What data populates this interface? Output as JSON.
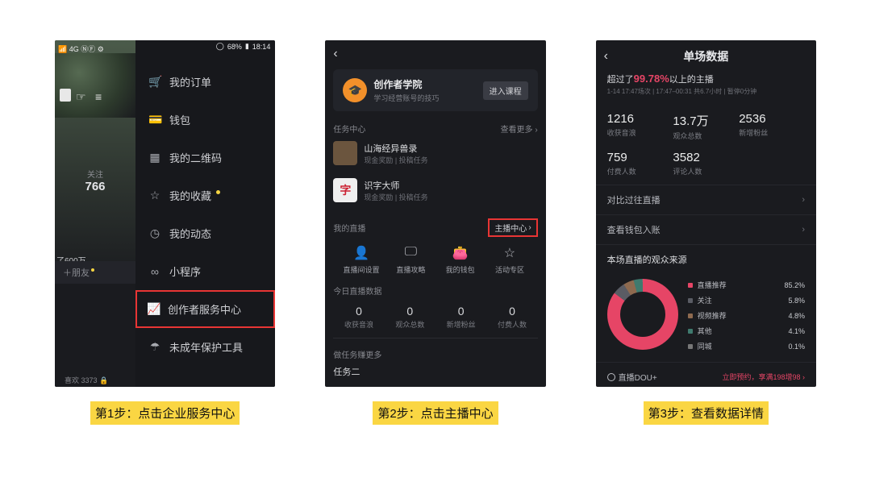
{
  "captions": {
    "step1": "第1步：点击企业服务中心",
    "step2": "第2步：点击主播中心",
    "step3": "第3步：查看数据详情"
  },
  "phone1": {
    "status_left_icons": "📶 4G ⓃⒻ ⚙",
    "battery": "68%",
    "time": "18:14",
    "follow_label": "关注",
    "follow_count": "766",
    "fans_text": "了600万",
    "add_friend": "＋朋友",
    "likes_text": "喜欢 3373",
    "lock_icon": "🔒",
    "menu": {
      "orders": "我的订单",
      "wallet": "钱包",
      "qrcode": "我的二维码",
      "fav": "我的收藏",
      "moments": "我的动态",
      "miniapp": "小程序",
      "creator": "创作者服务中心",
      "minor": "未成年保护工具"
    }
  },
  "phone2": {
    "academy": {
      "title": "创作者学院",
      "sub": "学习经营账号的技巧",
      "btn": "进入课程"
    },
    "task_header": "任务中心",
    "see_more": "查看更多 ›",
    "task1": {
      "title": "山海经异兽录",
      "sub": "现金奖励 | 投稿任务"
    },
    "task2": {
      "title": "识字大师",
      "thumb_char": "字",
      "sub": "现金奖励 | 投稿任务"
    },
    "my_live": "我的直播",
    "zb_center": "主播中心",
    "tools": {
      "t1": "直播间设置",
      "t2": "直播攻略",
      "t3": "我的钱包",
      "t4": "活动专区"
    },
    "today_header": "今日直播数据",
    "stats": {
      "s1v": "0",
      "s1l": "收获音浪",
      "s2v": "0",
      "s2l": "观众总数",
      "s3v": "0",
      "s3l": "新增粉丝",
      "s4v": "0",
      "s4l": "付费人数"
    },
    "more_task": "做任务赚更多",
    "task_two": "任务二"
  },
  "phone3": {
    "title": "单场数据",
    "exceed_pre": "超过了",
    "exceed_pct": "99.78%",
    "exceed_post": "以上的主播",
    "time_line": "1-14 17:47场次 | 17:47–00:31 共6.7小时 | 暂停0分钟",
    "grid": {
      "c1v": "1216",
      "c1l": "收获音浪",
      "c2v": "13.7万",
      "c2l": "观众总数",
      "c3v": "2536",
      "c3l": "新增粉丝",
      "c4v": "759",
      "c4l": "付费人数",
      "c5v": "3582",
      "c5l": "评论人数"
    },
    "compare": "对比过往直播",
    "wallet_in": "查看钱包入账",
    "source_title": "本场直播的观众来源",
    "legend": {
      "l1": "直播推荐",
      "p1": "85.2%",
      "l2": "关注",
      "p2": "5.8%",
      "l3": "视频推荐",
      "p3": "4.8%",
      "l4": "其他",
      "p4": "4.1%",
      "l5": "同城",
      "p5": "0.1%"
    },
    "dou_label": "直播DOU+",
    "dou_action": "立即预约，享满198增98 ›"
  },
  "chart_data": {
    "type": "pie",
    "title": "本场直播的观众来源",
    "categories": [
      "直播推荐",
      "关注",
      "视频推荐",
      "其他",
      "同城"
    ],
    "values": [
      85.2,
      5.8,
      4.8,
      4.1,
      0.1
    ],
    "colors": [
      "#e64566",
      "#5a5c64",
      "#8e6a4f",
      "#3f7a6e",
      "#777777"
    ]
  }
}
